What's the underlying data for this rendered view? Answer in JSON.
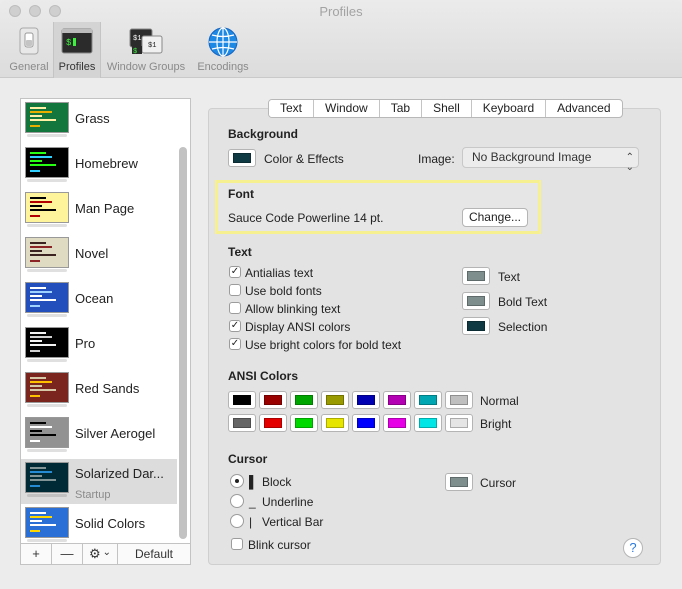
{
  "window": {
    "title": "Profiles"
  },
  "toolbar": {
    "items": [
      {
        "label": "General",
        "icon": "general-switch-icon"
      },
      {
        "label": "Profiles",
        "icon": "terminal-icon"
      },
      {
        "label": "Window Groups",
        "icon": "window-groups-icon"
      },
      {
        "label": "Encodings",
        "icon": "globe-icon"
      }
    ],
    "active": "Profiles"
  },
  "profiles": {
    "items": [
      {
        "name": "Grass",
        "bg": "#13773d",
        "fg": "#fff0a5",
        "accent": "#e7b000"
      },
      {
        "name": "Homebrew",
        "bg": "#000000",
        "fg": "#28fe14",
        "accent": "#2fd0ff"
      },
      {
        "name": "Man Page",
        "bg": "#fef49c",
        "fg": "#000000",
        "accent": "#b20000"
      },
      {
        "name": "Novel",
        "bg": "#dfdbc3",
        "fg": "#3b2322",
        "accent": "#8b2525"
      },
      {
        "name": "Ocean",
        "bg": "#224fbc",
        "fg": "#ffffff",
        "accent": "#9fd2ff"
      },
      {
        "name": "Pro",
        "bg": "#000000",
        "fg": "#f2f2f2",
        "accent": "#d0d0d0"
      },
      {
        "name": "Red Sands",
        "bg": "#7a251e",
        "fg": "#d7c9a7",
        "accent": "#ffc000"
      },
      {
        "name": "Silver Aerogel",
        "bg": "#929292",
        "fg": "#000000",
        "accent": "#ffffff"
      },
      {
        "name": "Solarized Dar...",
        "sub": "Startup",
        "bg": "#002b36",
        "fg": "#839496",
        "accent": "#268bd2",
        "selected": true
      },
      {
        "name": "Solid Colors",
        "bg": "#2a6fd6",
        "fg": "#ffffff",
        "accent": "#ffd700"
      }
    ],
    "footer": {
      "add": "+",
      "remove": "—",
      "gear": "⚙",
      "chevron": "⌄",
      "default": "Default"
    }
  },
  "tabs": [
    "Text",
    "Window",
    "Tab",
    "Shell",
    "Keyboard",
    "Advanced"
  ],
  "selected_tab": "Text",
  "background": {
    "title": "Background",
    "color_effects_label": "Color & Effects",
    "color": "#0f3a44",
    "image_label": "Image:",
    "image_value": "No Background Image"
  },
  "font": {
    "title": "Font",
    "value": "Sauce Code Powerline 14 pt.",
    "change_button": "Change..."
  },
  "text": {
    "title": "Text",
    "options": [
      {
        "label": "Antialias text",
        "checked": true
      },
      {
        "label": "Use bold fonts",
        "checked": false
      },
      {
        "label": "Allow blinking text",
        "checked": false
      },
      {
        "label": "Display ANSI colors",
        "checked": true
      },
      {
        "label": "Use bright colors for bold text",
        "checked": true
      }
    ],
    "colors": [
      {
        "label": "Text",
        "color": "#7e8e8c"
      },
      {
        "label": "Bold Text",
        "color": "#7e8e8c"
      },
      {
        "label": "Selection",
        "color": "#0f3a44"
      }
    ]
  },
  "ansi": {
    "title": "ANSI Colors",
    "normal_label": "Normal",
    "bright_label": "Bright",
    "normal": [
      "#000000",
      "#990000",
      "#00a600",
      "#999900",
      "#0000b2",
      "#b200b2",
      "#00a6b2",
      "#bfbfbf"
    ],
    "bright": [
      "#666666",
      "#e50000",
      "#00d900",
      "#e5e500",
      "#0000ff",
      "#e500e5",
      "#00e5e5",
      "#e5e5e5"
    ]
  },
  "cursor": {
    "title": "Cursor",
    "options": [
      {
        "glyph": "▌",
        "label": "Block",
        "selected": true
      },
      {
        "glyph": "_",
        "label": "Underline",
        "selected": false
      },
      {
        "glyph": "|",
        "label": "Vertical Bar",
        "selected": false
      }
    ],
    "blink_label": "Blink cursor",
    "blink_checked": false,
    "color_label": "Cursor",
    "color": "#7e8e8c"
  },
  "help": "?"
}
